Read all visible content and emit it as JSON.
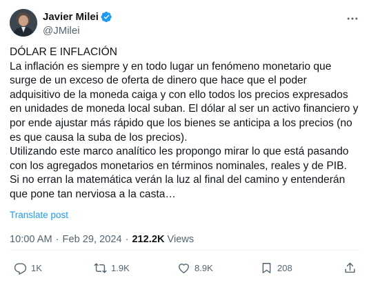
{
  "author": {
    "display_name": "Javier Milei",
    "handle": "@JMilei"
  },
  "post": {
    "lines": [
      "DÓLAR E INFLACIÓN",
      "La inflación es siempre y en todo lugar un fenómeno monetario que",
      "surge de un exceso de oferta de dinero que hace que el poder",
      "adquisitivo de la moneda caiga y con ello todos los precios expresados",
      "en unidades de moneda local suban. El dólar al ser un activo financiero y",
      "por ende ajustar más rápido que los bienes se anticipa a los precios (no",
      "es que causa la suba de los precios).",
      "Utilizando este marco analítico les propongo mirar lo que está pasando",
      "con los agregados monetarios en términos nominales, reales y de PIB.",
      "Si no erran la matemática verán la luz al final del camino y entenderán",
      "que pone tan nerviosa a la casta…"
    ],
    "translate_label": "Translate post"
  },
  "meta": {
    "time": "10:00 AM",
    "separator": "·",
    "date": "Feb 29, 2024",
    "views_count": "212.2K",
    "views_label": "Views"
  },
  "actions": {
    "replies": "1K",
    "reposts": "1.9K",
    "likes": "8.9K",
    "bookmarks": "208"
  },
  "icons": [
    "verified-badge-icon",
    "more-icon",
    "reply-icon",
    "repost-icon",
    "like-icon",
    "bookmark-icon",
    "share-icon"
  ],
  "colors": {
    "accent": "#1d9bf0",
    "text_primary": "#0f1419",
    "text_secondary": "#536471",
    "divider": "#eff3f4"
  }
}
